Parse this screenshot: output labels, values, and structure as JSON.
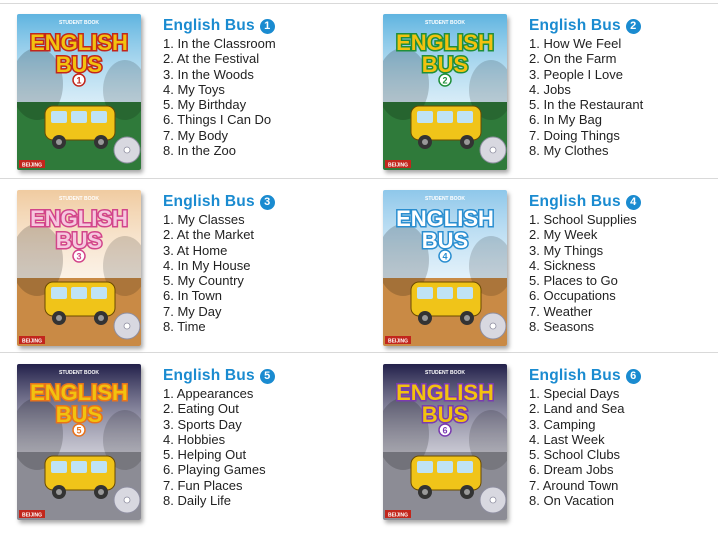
{
  "books": [
    {
      "title": "English Bus",
      "number": "1",
      "cover": {
        "label_top": "STUDENT BOOK",
        "logo_line1": "ENGLISH",
        "logo_line2": "BUS",
        "publisher": "BEIJING",
        "bg": "#2f7a3a",
        "sky": "#5fb4e0",
        "logo_fill": "#f2c20f",
        "logo_stroke": "#c2261c",
        "bus": "#f0c419"
      },
      "lessons": [
        "1. In the Classroom",
        "2. At the Festival",
        "3. In the Woods",
        "4. My Toys",
        "5. My Birthday",
        "6. Things I Can Do",
        "7. My Body",
        "8. In the Zoo"
      ]
    },
    {
      "title": "English Bus",
      "number": "2",
      "cover": {
        "label_top": "STUDENT BOOK",
        "logo_line1": "ENGLISH",
        "logo_line2": "BUS",
        "publisher": "BEIJING",
        "bg": "#2f7a3a",
        "sky": "#5fb4e0",
        "logo_fill": "#f2c20f",
        "logo_stroke": "#1f8f3a",
        "bus": "#f0c419"
      },
      "lessons": [
        "1. How We Feel",
        "2. On the Farm",
        "3. People I Love",
        "4. Jobs",
        "5. In the Restaurant",
        "6. In My Bag",
        "7. Doing Things",
        "8. My Clothes"
      ]
    },
    {
      "title": "English Bus",
      "number": "3",
      "cover": {
        "label_top": "STUDENT BOOK",
        "logo_line1": "ENGLISH",
        "logo_line2": "BUS",
        "publisher": "BEIJING",
        "bg": "#c98a45",
        "sky": "#f0cba0",
        "logo_fill": "#f6c7de",
        "logo_stroke": "#d2448a",
        "bus": "#f0c419"
      },
      "lessons": [
        "1. My Classes",
        "2. At the Market",
        "3. At Home",
        "4. In My House",
        "5. My Country",
        "6. In Town",
        "7. My Day",
        "8. Time"
      ]
    },
    {
      "title": "English Bus",
      "number": "4",
      "cover": {
        "label_top": "STUDENT BOOK",
        "logo_line1": "ENGLISH",
        "logo_line2": "BUS",
        "publisher": "BEIJING",
        "bg": "#c98a45",
        "sky": "#8ec7ea",
        "logo_fill": "#ffffff",
        "logo_stroke": "#2a8ed0",
        "bus": "#f0c419"
      },
      "lessons": [
        "1. School Supplies",
        "2. My Week",
        "3. My Things",
        "4. Sickness",
        "5. Places to Go",
        "6. Occupations",
        "7. Weather",
        "8. Seasons"
      ]
    },
    {
      "title": "English Bus",
      "number": "5",
      "cover": {
        "label_top": "STUDENT BOOK",
        "logo_line1": "ENGLISH",
        "logo_line2": "BUS",
        "publisher": "BEIJING",
        "bg": "#8c8c95",
        "sky": "#22204a",
        "logo_fill": "#f2c20f",
        "logo_stroke": "#e8731c",
        "bus": "#f0c419"
      },
      "lessons": [
        "1. Appearances",
        "2. Eating Out",
        "3. Sports Day",
        "4. Hobbies",
        "5. Helping Out",
        "6. Playing Games",
        "7. Fun Places",
        "8. Daily Life"
      ]
    },
    {
      "title": "English Bus",
      "number": "6",
      "cover": {
        "label_top": "STUDENT BOOK",
        "logo_line1": "ENGLISH",
        "logo_line2": "BUS",
        "publisher": "BEIJING",
        "bg": "#8c8c95",
        "sky": "#22204a",
        "logo_fill": "#f2c20f",
        "logo_stroke": "#7a3bb0",
        "bus": "#f0c419"
      },
      "lessons": [
        "1. Special Days",
        "2. Land and Sea",
        "3. Camping",
        "4. Last Week",
        "5. School Clubs",
        "6. Dream Jobs",
        "7. Around Town",
        "8. On Vacation"
      ]
    }
  ]
}
